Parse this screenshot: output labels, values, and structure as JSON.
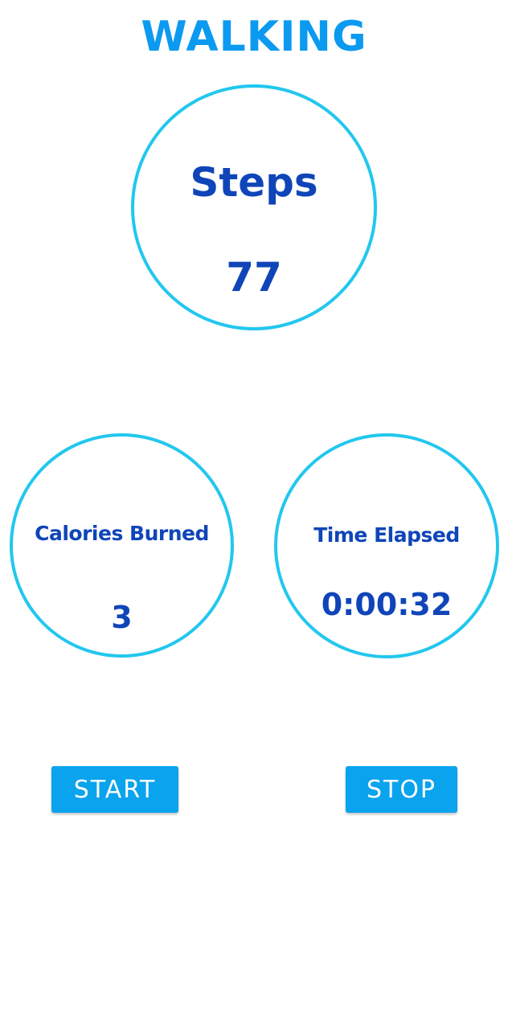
{
  "app": {
    "title": "WALKING"
  },
  "stats": {
    "steps": {
      "label": "Steps",
      "value": "77"
    },
    "calories": {
      "label": "Calories Burned",
      "value": "3"
    },
    "time": {
      "label": "Time Elapsed",
      "value": "0:00:32"
    }
  },
  "controls": {
    "start_label": "START",
    "stop_label": "STOP"
  },
  "colors": {
    "title": "#0b9af0",
    "ring": "#22c7ee",
    "text": "#0f45b8",
    "button": "#0aa3ee"
  }
}
